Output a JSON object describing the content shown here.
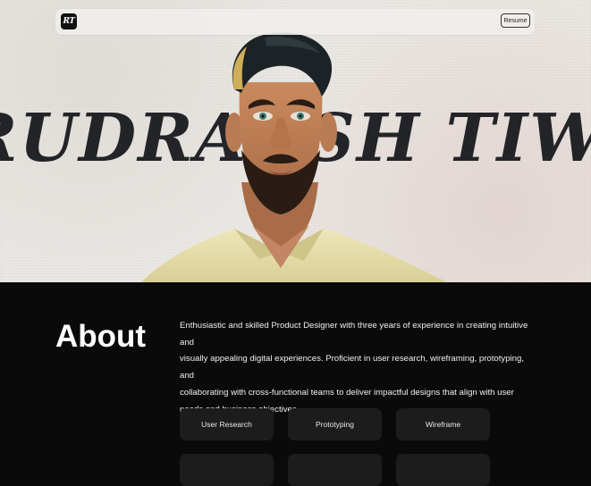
{
  "header": {
    "logo_text": "RT",
    "resume_label": "Resume"
  },
  "hero": {
    "name_text": "RUDRAKSH TIWARI"
  },
  "about": {
    "title": "About",
    "lines": [
      "Enthusiastic and skilled Product Designer with three years of experience in creating intuitive and",
      "visually appealing digital experiences. Proficient in user research, wireframing, prototyping, and",
      "collaborating with cross-functional teams to deliver impactful designs that align with user",
      "needs and business objectives."
    ]
  },
  "skills": [
    "User Research",
    "Prototyping",
    "Wireframe",
    "",
    "",
    ""
  ],
  "colors": {
    "page_bg": "#0a0a0a",
    "hero_bg": "#ece9e5",
    "chip_bg": "#1c1c1c",
    "text": "#ffffff"
  }
}
